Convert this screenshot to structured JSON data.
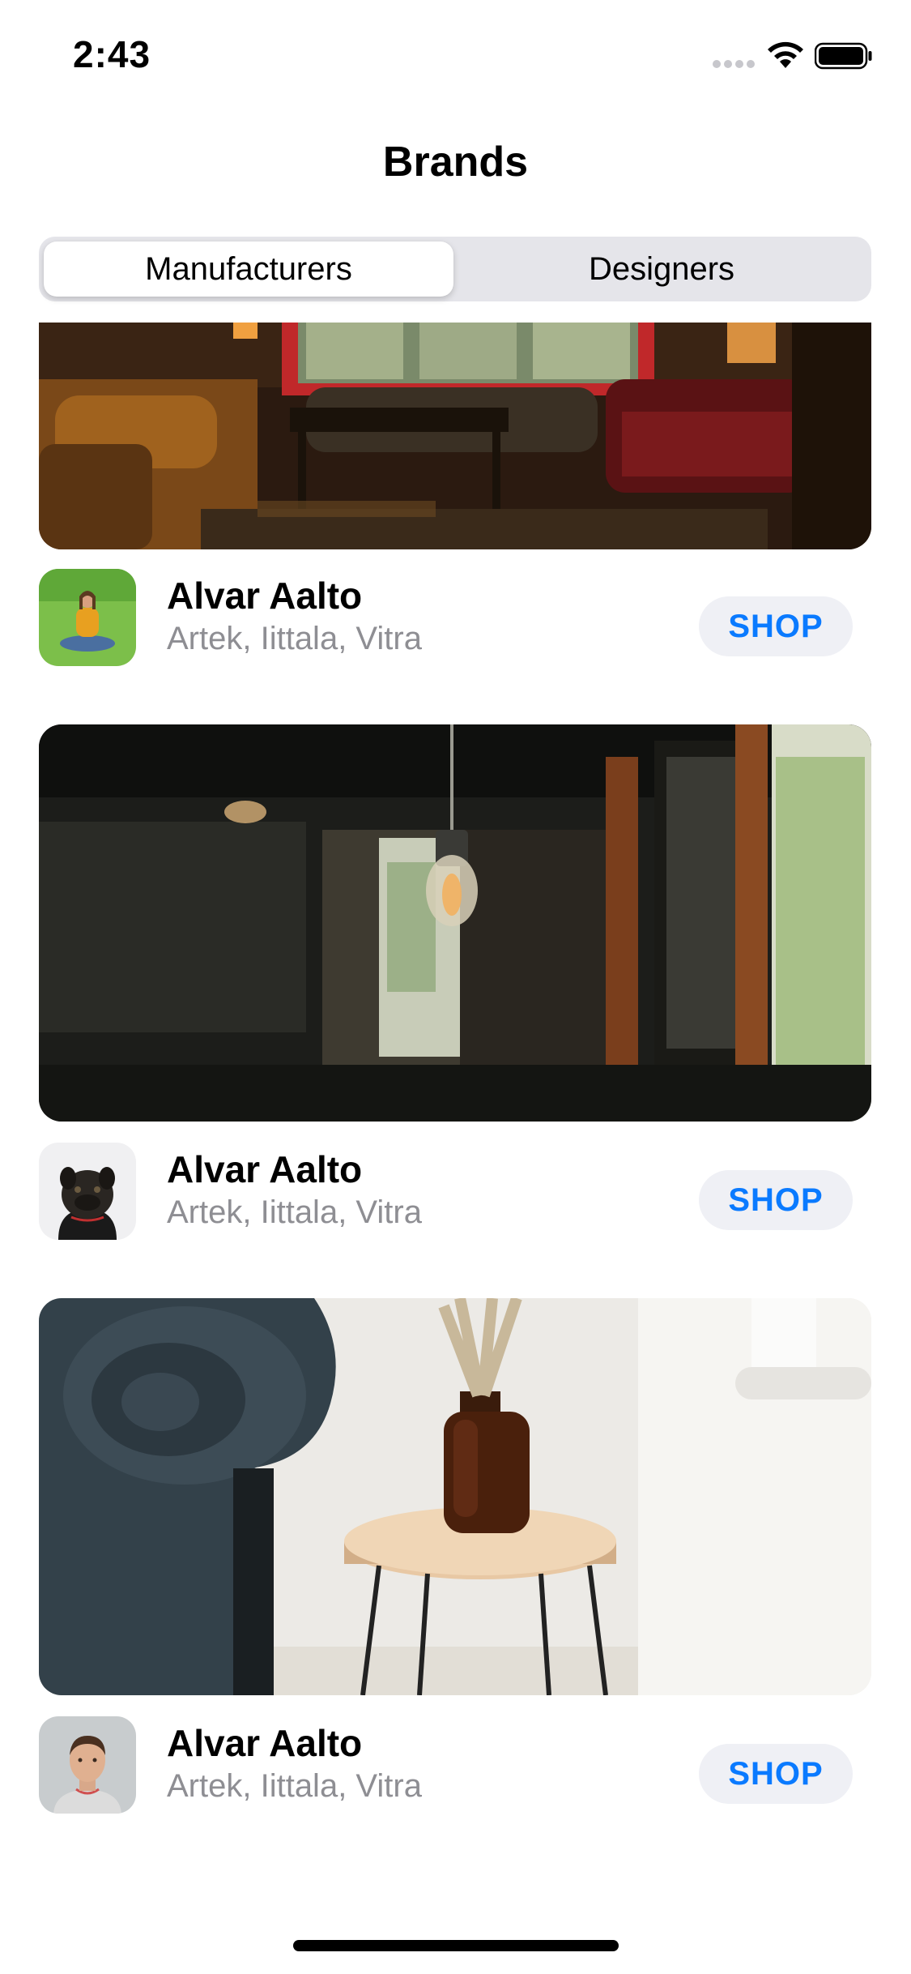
{
  "status_bar": {
    "time": "2:43",
    "icons": [
      "signal-dots-icon",
      "wifi-icon",
      "battery-icon"
    ]
  },
  "navigation": {
    "title": "Brands"
  },
  "segmented_control": {
    "segments": [
      {
        "label": "Manufacturers",
        "selected": true
      },
      {
        "label": "Designers",
        "selected": false
      }
    ]
  },
  "brands": [
    {
      "image": "living-room-photo",
      "avatar": "woman-on-grass-photo",
      "name": "Alvar Aalto",
      "subtitle": "Artek, Iittala, Vitra",
      "button": "SHOP"
    },
    {
      "image": "hanging-bulb-photo",
      "avatar": "pug-dog-photo",
      "name": "Alvar Aalto",
      "subtitle": "Artek, Iittala, Vitra",
      "button": "SHOP"
    },
    {
      "image": "side-table-vase-photo",
      "avatar": "man-portrait-photo",
      "name": "Alvar Aalto",
      "subtitle": "Artek, Iittala, Vitra",
      "button": "SHOP"
    }
  ],
  "colors": {
    "accent": "#0a7aff",
    "secondary_text": "#8e8e93",
    "segment_bg": "#e5e5ea",
    "button_bg": "#eff0f5"
  }
}
